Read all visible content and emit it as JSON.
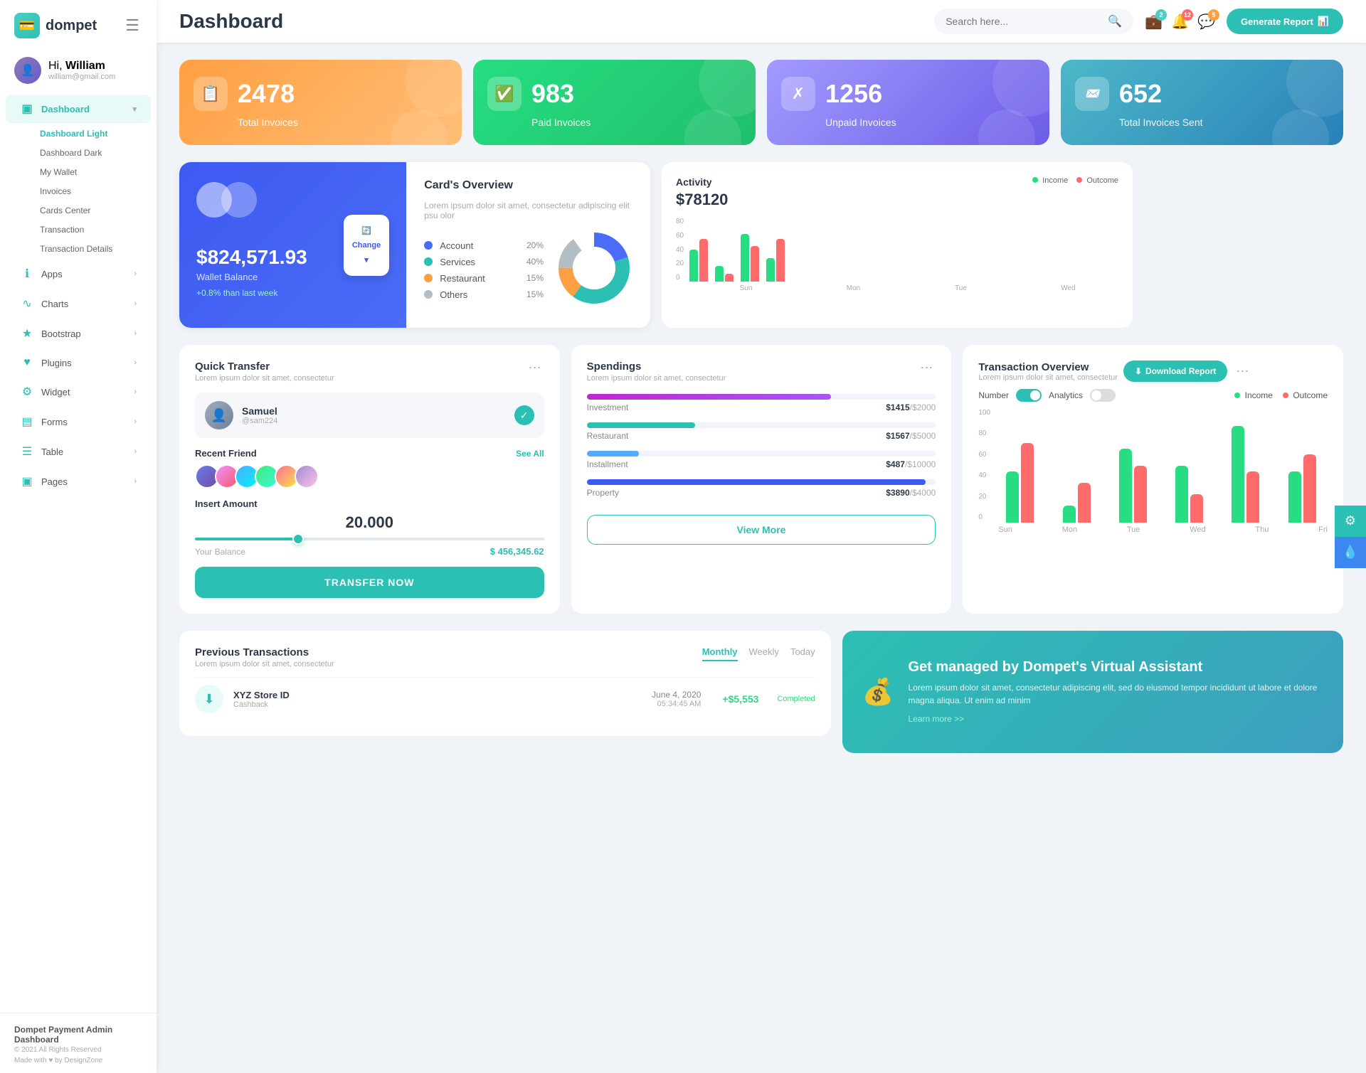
{
  "app": {
    "logo_text": "dompet",
    "logo_icon": "💳"
  },
  "header": {
    "title": "Dashboard",
    "search_placeholder": "Search here...",
    "generate_btn": "Generate Report",
    "badges": {
      "wallet": "2",
      "bell": "12",
      "chat": "5"
    }
  },
  "user": {
    "greeting": "Hi,",
    "name": "William",
    "email": "william@gmail.com"
  },
  "sidebar": {
    "nav": [
      {
        "label": "Dashboard",
        "icon": "▣",
        "active": true,
        "arrow": "▾"
      },
      {
        "label": "Apps",
        "icon": "ℹ",
        "arrow": "›"
      },
      {
        "label": "Charts",
        "icon": "∿",
        "arrow": "›"
      },
      {
        "label": "Bootstrap",
        "icon": "★",
        "arrow": "›"
      },
      {
        "label": "Plugins",
        "icon": "♥",
        "arrow": "›"
      },
      {
        "label": "Widget",
        "icon": "⚙",
        "arrow": "›"
      },
      {
        "label": "Forms",
        "icon": "▤",
        "arrow": "›"
      },
      {
        "label": "Table",
        "icon": "☰",
        "arrow": "›"
      },
      {
        "label": "Pages",
        "icon": "▣",
        "arrow": "›"
      }
    ],
    "sub_items": [
      {
        "label": "Dashboard Light",
        "active": true
      },
      {
        "label": "Dashboard Dark",
        "active": false
      },
      {
        "label": "My Wallet",
        "active": false
      },
      {
        "label": "Invoices",
        "active": false
      },
      {
        "label": "Cards Center",
        "active": false
      },
      {
        "label": "Transaction",
        "active": false
      },
      {
        "label": "Transaction Details",
        "active": false
      }
    ],
    "footer": {
      "brand": "Dompet Payment Admin Dashboard",
      "copy": "© 2021 All Rights Reserved",
      "made": "Made with ♥ by DesignZone"
    }
  },
  "stats": [
    {
      "label": "Total Invoices",
      "value": "2478",
      "icon": "📋",
      "color": "orange"
    },
    {
      "label": "Paid Invoices",
      "value": "983",
      "icon": "✅",
      "color": "green"
    },
    {
      "label": "Unpaid Invoices",
      "value": "1256",
      "icon": "✗",
      "color": "purple"
    },
    {
      "label": "Total Invoices Sent",
      "value": "652",
      "icon": "📨",
      "color": "teal"
    }
  ],
  "card_panel": {
    "balance": "$824,571.93",
    "label": "Wallet Balance",
    "change": "+0.8% than last week",
    "change_btn": "Change"
  },
  "cards_overview": {
    "title": "Card's Overview",
    "desc": "Lorem ipsum dolor sit amet, consectetur adipiscing elit psu olor",
    "items": [
      {
        "label": "Account",
        "pct": "20%",
        "color": "#4a6cf7"
      },
      {
        "label": "Services",
        "pct": "40%",
        "color": "#2cbfb3"
      },
      {
        "label": "Restaurant",
        "pct": "15%",
        "color": "#ff9f43"
      },
      {
        "label": "Others",
        "pct": "15%",
        "color": "#b2bec3"
      }
    ]
  },
  "activity": {
    "title": "Activity",
    "amount": "$78120",
    "income_label": "Income",
    "outcome_label": "Outcome",
    "bars": {
      "labels": [
        "Sun",
        "Mon",
        "Tue",
        "Wed"
      ],
      "income": [
        40,
        20,
        60,
        30
      ],
      "outcome": [
        55,
        10,
        45,
        55
      ]
    },
    "y_labels": [
      "0",
      "20",
      "40",
      "60",
      "80"
    ]
  },
  "quick_transfer": {
    "title": "Quick Transfer",
    "desc": "Lorem ipsum dolor sit amet, consectetur",
    "user_name": "Samuel",
    "user_handle": "@sam224",
    "recent_label": "Recent Friend",
    "see_all": "See All",
    "insert_label": "Insert Amount",
    "amount": "20.000",
    "balance_label": "Your Balance",
    "balance_value": "$ 456,345.62",
    "transfer_btn": "TRANSFER NOW"
  },
  "spendings": {
    "title": "Spendings",
    "desc": "Lorem ipsum dolor sit amet, consectetur",
    "items": [
      {
        "label": "Investment",
        "amount": "$1415",
        "total": "/$2000",
        "pct": 70,
        "color": "#a855f7"
      },
      {
        "label": "Restaurant",
        "amount": "$1567",
        "total": "/$5000",
        "pct": 31,
        "color": "#2cbfb3"
      },
      {
        "label": "Installment",
        "amount": "$487",
        "total": "/$10000",
        "pct": 15,
        "color": "#4facfe"
      },
      {
        "label": "Property",
        "amount": "$3890",
        "total": "/$4000",
        "pct": 97,
        "color": "#3d5af1"
      }
    ],
    "view_btn": "View More"
  },
  "tx_overview": {
    "title": "Transaction Overview",
    "desc": "Lorem ipsum dolor sit amet, consectetur",
    "download_btn": "Download Report",
    "toggle_number": "Number",
    "toggle_analytics": "Analytics",
    "income_label": "Income",
    "outcome_label": "Outcome",
    "bars": {
      "labels": [
        "Sun",
        "Mon",
        "Tue",
        "Wed",
        "Thu",
        "Fri"
      ],
      "income": [
        45,
        15,
        65,
        50,
        85,
        45
      ],
      "outcome": [
        70,
        35,
        50,
        25,
        45,
        60
      ]
    },
    "y_labels": [
      "0",
      "20",
      "40",
      "60",
      "80",
      "100"
    ]
  },
  "prev_tx": {
    "title": "Previous Transactions",
    "desc": "Lorem ipsum dolor sit amet, consectetur",
    "tabs": [
      "Monthly",
      "Weekly",
      "Today"
    ],
    "active_tab": "Monthly",
    "rows": [
      {
        "name": "XYZ Store ID",
        "type": "Cashback",
        "date": "June 4, 2020",
        "time": "05:34:45 AM",
        "amount": "+$5,553",
        "status": "Completed",
        "icon": "⬇"
      }
    ]
  },
  "va_banner": {
    "title": "Get managed by Dompet's Virtual Assistant",
    "desc": "Lorem ipsum dolor sit amet, consectetur adipiscing elit, sed do eiusmod tempor incididunt ut labore et dolore magna aliqua. Ut enim ad minim",
    "link": "Learn more >>"
  }
}
